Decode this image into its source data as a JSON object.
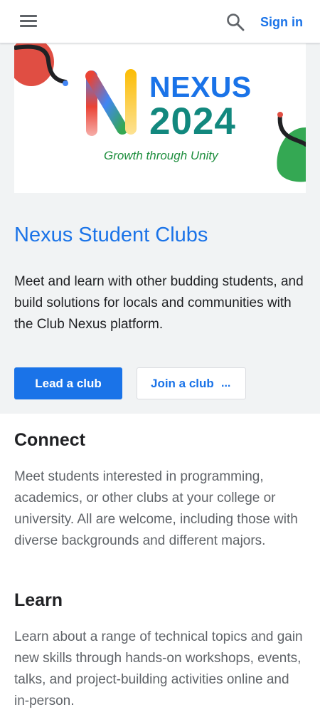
{
  "header": {
    "menu_icon": "hamburger-menu-icon",
    "search_icon": "search-icon",
    "sign_in_label": "Sign in"
  },
  "banner": {
    "logo_letter": "N",
    "brand_name": "NEXUS",
    "year": "2024",
    "tagline": "Growth through Unity"
  },
  "hero": {
    "title": "Nexus Student Clubs",
    "description": "Meet and learn with other budding students, and build solutions for locals and communities with the Club Nexus platform.",
    "primary_button": "Lead a club",
    "secondary_button": "Join a club",
    "secondary_button_overflow": "..."
  },
  "sections": [
    {
      "title": "Connect",
      "text": "Meet students interested in programming, academics, or other clubs at your college or university. All are welcome, including those with diverse backgrounds and different majors."
    },
    {
      "title": "Learn",
      "text": "Learn about a range of technical topics and gain new skills through hands-on workshops, events, talks, and project-building activities online and in-person."
    }
  ],
  "colors": {
    "brand_blue": "#1a73e8",
    "nexus_teal": "#12887e",
    "tagline_green": "#1e8e3e",
    "decor_red": "#e04e43",
    "decor_green": "#34a853"
  }
}
